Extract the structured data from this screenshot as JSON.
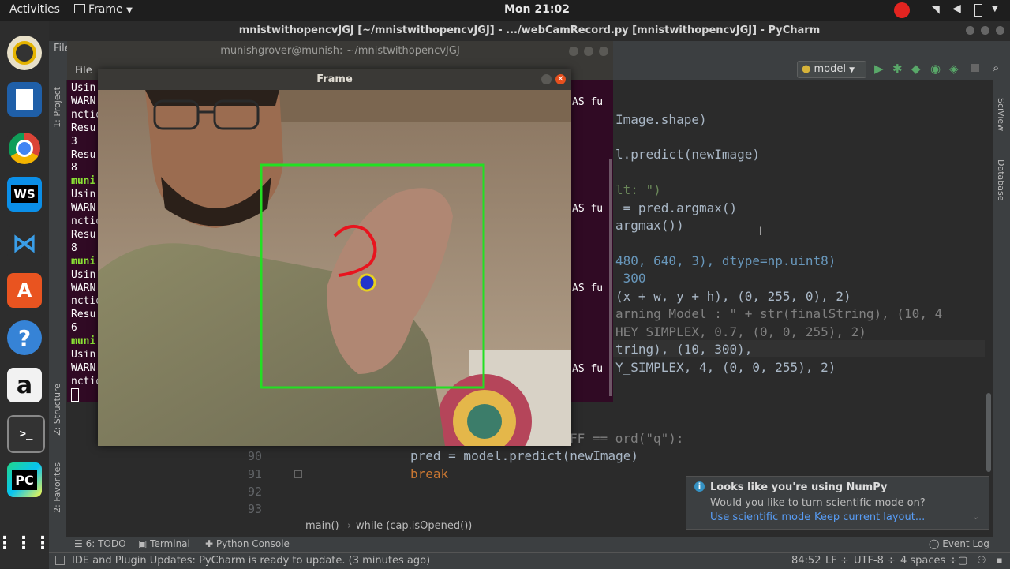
{
  "topbar": {
    "activities": "Activities",
    "app_menu": "Frame",
    "clock": "Mon 21:02"
  },
  "dock": {
    "items": [
      {
        "name": "rhythmbox",
        "label": ""
      },
      {
        "name": "writer",
        "label": ""
      },
      {
        "name": "chrome",
        "label": ""
      },
      {
        "name": "webstorm",
        "label": "WS"
      },
      {
        "name": "vscode",
        "label": ""
      },
      {
        "name": "software",
        "label": ""
      },
      {
        "name": "help",
        "label": "?"
      },
      {
        "name": "amazon",
        "label": "a"
      },
      {
        "name": "terminal",
        "label": ">_"
      },
      {
        "name": "pycharm",
        "label": "PC"
      },
      {
        "name": "apps-grid",
        "label": ""
      }
    ]
  },
  "pycharm": {
    "title": "mnistwithopencvJGJ [~/mnistwithopencvJGJ] - .../webCamRecord.py [mnistwithopencvJGJ] - PyCharm",
    "menu_file": "File",
    "run_config": "model",
    "left_tabs": {
      "project": "1: Project",
      "structure": "Z: Structure",
      "favorites": "2: Favorites"
    },
    "right_tabs": {
      "sciview": "SciView",
      "database": "Database"
    },
    "code_lines": [
      {
        "text": "Image.shape)"
      },
      {
        "text": "l.predict(newImage)"
      },
      {
        "text": "lt: \")"
      },
      {
        "text": " = pred.argmax()"
      },
      {
        "text": "argmax())"
      },
      {
        "text": "480, 640, 3), dtype=np.uint8)"
      },
      {
        "text": " 300"
      },
      {
        "text": "(x + w, y + h), (0, 255, 0), 2)"
      },
      {
        "text": "arning Model : \" + str(finalString), (10, 4"
      },
      {
        "text": "HEY_SIMPLEX, 0.7, (0, 0, 255), 2)"
      },
      {
        "text": "tring), (10, 300),"
      },
      {
        "text": "Y_SIMPLEX, 4, (0, 0, 255), 2)"
      },
      {
        "text": "FF == ord(\"q\"):"
      }
    ],
    "line_numbers": [
      "90",
      "91",
      "92",
      "93"
    ],
    "code_bottom": {
      "line90": "pred = model.predict(newImage)",
      "line91": "break"
    },
    "breadcrumb": {
      "item1": "main()",
      "item2": "while (cap.isOpened())"
    },
    "toolwindows": {
      "todo": "6: TODO",
      "terminal": "Terminal",
      "python_console": "Python Console",
      "event_log": "Event Log"
    },
    "status": {
      "message": "IDE and Plugin Updates: PyCharm is ready to update. (3 minutes ago)",
      "position": "84:52",
      "line_sep": "LF ÷",
      "encoding": "UTF-8 ÷",
      "indent": "4 spaces ÷"
    },
    "notification": {
      "title": "Looks like you're using NumPy",
      "body": "Would you like to turn scientific mode on?",
      "link1": "Use scientific mode",
      "link2": "Keep current layout..."
    }
  },
  "terminal": {
    "title": "munishgrover@munish: ~/mnistwithopencvJGJ",
    "menu_file": "File",
    "lines": [
      "Usin",
      "WARN",
      "nctio",
      "Resu",
      "3",
      "Resu",
      "8",
      "muni",
      "Usin",
      "WARN",
      "nctio",
      "Resu",
      "8",
      "muni",
      "Usin",
      "WARN",
      "nctio",
      "Resu",
      "6",
      "muni",
      "Usin",
      "WARN",
      "nctio"
    ],
    "right_fragments": [
      "AS fu",
      "AS fu",
      "AS fu",
      "AS fu"
    ]
  },
  "frame": {
    "title": "Frame"
  },
  "colors": {
    "terminal_bg": "#300a24",
    "editor_bg": "#2b2b2b",
    "box": "#22e022",
    "drawn": "#e8141e"
  }
}
